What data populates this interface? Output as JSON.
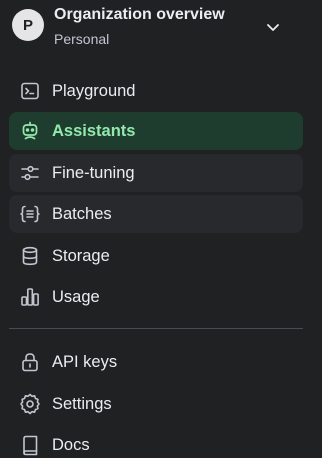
{
  "org": {
    "avatar_letter": "P",
    "name": "Organization overview",
    "subtitle": "Personal"
  },
  "nav_primary": [
    {
      "label": "Playground",
      "icon": "terminal-icon"
    },
    {
      "label": "Assistants",
      "icon": "robot-icon",
      "active": true
    },
    {
      "label": "Fine-tuning",
      "icon": "sliders-icon"
    },
    {
      "label": "Batches",
      "icon": "braces-list-icon"
    },
    {
      "label": "Storage",
      "icon": "database-icon"
    },
    {
      "label": "Usage",
      "icon": "bar-chart-icon"
    }
  ],
  "nav_secondary": [
    {
      "label": "API keys",
      "icon": "lock-icon"
    },
    {
      "label": "Settings",
      "icon": "gear-icon"
    },
    {
      "label": "Docs",
      "icon": "book-icon"
    }
  ],
  "colors": {
    "background": "#202123",
    "active_background": "#1f3d2f",
    "active_text": "#92e9ab",
    "text": "#ececf1",
    "divider": "#4a4b52"
  }
}
